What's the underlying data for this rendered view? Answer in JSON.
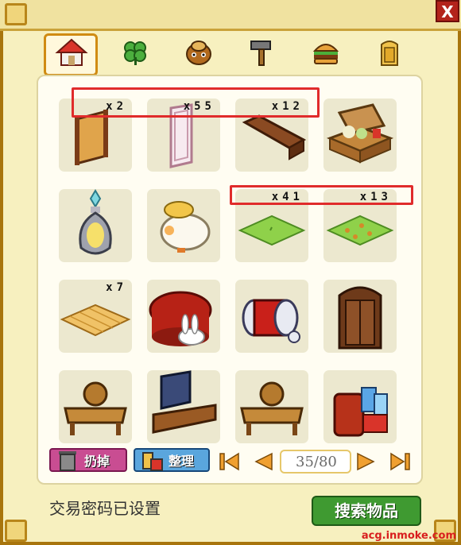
{
  "window": {
    "close_label": "X"
  },
  "tabs": [
    {
      "name": "house",
      "active": true
    },
    {
      "name": "clover",
      "active": false
    },
    {
      "name": "coin-face",
      "active": false
    },
    {
      "name": "hammer",
      "active": false
    },
    {
      "name": "burger",
      "active": false
    },
    {
      "name": "door",
      "active": false
    }
  ],
  "items": [
    {
      "name": "wooden-screen",
      "qty": "x2"
    },
    {
      "name": "glass-door",
      "qty": "x55"
    },
    {
      "name": "wooden-beam",
      "qty": "x12"
    },
    {
      "name": "open-suitcase",
      "qty": ""
    },
    {
      "name": "crystal-lantern",
      "qty": ""
    },
    {
      "name": "duck-plush",
      "qty": ""
    },
    {
      "name": "grass-tile",
      "qty": "x41"
    },
    {
      "name": "grass-leaf-tile",
      "qty": "x13"
    },
    {
      "name": "wood-floor-tile",
      "qty": "x7"
    },
    {
      "name": "red-tea-table-rabbit",
      "qty": ""
    },
    {
      "name": "red-drum",
      "qty": ""
    },
    {
      "name": "wooden-wardrobe",
      "qty": ""
    },
    {
      "name": "wooden-bench",
      "qty": ""
    },
    {
      "name": "tv-stand",
      "qty": ""
    },
    {
      "name": "wooden-bench-2",
      "qty": ""
    },
    {
      "name": "gift-bags-chair",
      "qty": ""
    }
  ],
  "controls": {
    "discard_label": "扔掉",
    "sort_label": "整理",
    "page": "35/80"
  },
  "status_text": "交易密码已设置",
  "search_label": "搜索物品",
  "watermark": "acg.inmoke.com"
}
